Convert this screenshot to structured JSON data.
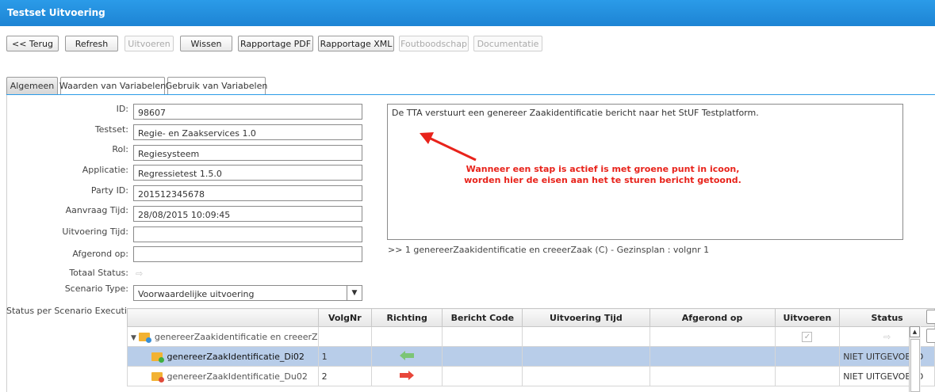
{
  "window": {
    "title": "Testset Uitvoering"
  },
  "toolbar": [
    {
      "label": "<< Terug",
      "enabled": true
    },
    {
      "label": "Refresh",
      "enabled": true
    },
    {
      "label": "Uitvoeren",
      "enabled": false
    },
    {
      "label": "Wissen",
      "enabled": true
    },
    {
      "label": "Rapportage PDF",
      "enabled": true
    },
    {
      "label": "Rapportage XML",
      "enabled": true
    },
    {
      "label": "Foutboodschap",
      "enabled": false
    },
    {
      "label": "Documentatie",
      "enabled": false
    }
  ],
  "tabs": [
    {
      "label": "Algemeen",
      "active": true
    },
    {
      "label": "Waarden van Variabelen",
      "active": false
    },
    {
      "label": "Gebruik van Variabelen",
      "active": false
    }
  ],
  "form": {
    "id": {
      "label": "ID:",
      "value": "98607"
    },
    "testset": {
      "label": "Testset:",
      "value": "Regie- en Zaakservices 1.0"
    },
    "rol": {
      "label": "Rol:",
      "value": "Regiesysteem"
    },
    "applicatie": {
      "label": "Applicatie:",
      "value": "Regressietest 1.5.0"
    },
    "party": {
      "label": "Party ID:",
      "value": "201512345678"
    },
    "aanvraag": {
      "label": "Aanvraag Tijd:",
      "value": "28/08/2015 10:09:45"
    },
    "uitvoering": {
      "label": "Uitvoering Tijd:",
      "value": ""
    },
    "afgerond": {
      "label": "Afgerond op:",
      "value": ""
    },
    "totaal": {
      "label": "Totaal Status:"
    },
    "scenario": {
      "label": "Scenario Type:",
      "value": "Voorwaardelijke uitvoering"
    },
    "status_per": {
      "label": "Status per Scenario Executie:"
    }
  },
  "description": "De TTA verstuurt een genereer Zaakidentificatie bericht naar het StUF Testplatform.",
  "annotation": {
    "line1": "Wanneer een stap is actief is met groene punt in icoon,",
    "line2": "worden hier de eisen aan het te sturen bericht getoond.",
    "color": "#e8231b"
  },
  "step_info": ">> 1 genereerZaakidentificatie en creeerZaak (C) - Gezinsplan : volgnr 1",
  "grid": {
    "headers": [
      "",
      "VolgNr",
      "Richting",
      "Bericht Code",
      "Uitvoering Tijd",
      "Afgerond op",
      "Uitvoeren",
      "Status"
    ],
    "rows": [
      {
        "name": "genereerZaakidentificatie en creeerZ",
        "volgnr": "",
        "richting": "",
        "status": "",
        "dot": "#3a8fd6"
      },
      {
        "name": "genereerZaakIdentificatie_Di02",
        "volgnr": "1",
        "richting": "in",
        "status": "NIET UITGEVOERD",
        "dot": "#3fae3f"
      },
      {
        "name": "genereerZaakIdentificatie_Du02",
        "volgnr": "2",
        "richting": "out",
        "status": "NIET UITGEVOERD",
        "dot": "#e04b3a"
      }
    ]
  },
  "colors": {
    "accent": "#2b9be8",
    "selected_row": "#b8cde9"
  }
}
